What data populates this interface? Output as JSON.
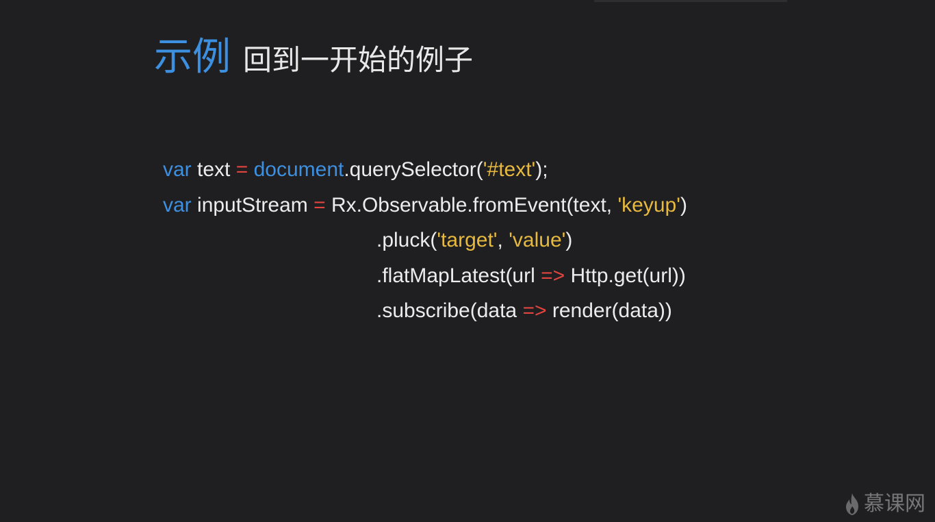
{
  "slide": {
    "title_main": "示例",
    "title_sub": "回到一开始的例子"
  },
  "code": {
    "line1": {
      "kw_var": "var",
      "name": " text ",
      "op_eq": "=",
      "sp": " ",
      "kw_document": "document",
      "call": ".querySelector(",
      "str": "'#text'",
      "end": ");"
    },
    "line2": {
      "kw_var": "var",
      "name": " inputStream ",
      "op_eq": "=",
      "call": " Rx.Observable.fromEvent(text, ",
      "str": "'keyup'",
      "end": ")"
    },
    "line3": {
      "call": ".pluck(",
      "str1": "'target'",
      "comma": ", ",
      "str2": "'value'",
      "end": ")"
    },
    "line4": {
      "call": ".flatMapLatest(url ",
      "op_arrow": "=>",
      "end": " Http.get(url))"
    },
    "line5": {
      "call": ".subscribe(data ",
      "op_arrow": "=>",
      "end": " render(data))"
    }
  },
  "watermark": {
    "text": "慕课网"
  },
  "colors": {
    "background": "#1f1f21",
    "keyword_blue": "#3d8fe0",
    "operator_red": "#e2443f",
    "string_yellow": "#e7b93e",
    "text": "#ececec"
  },
  "icons": {
    "logo": "flame-icon"
  }
}
